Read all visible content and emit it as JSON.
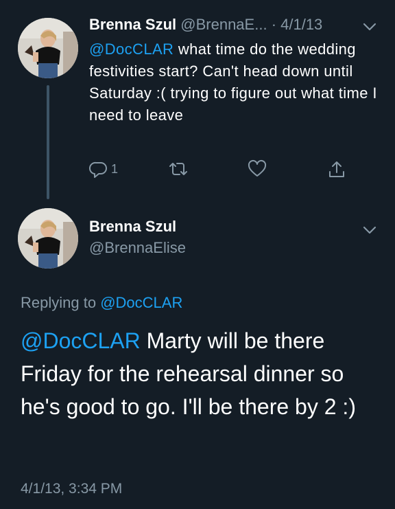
{
  "tweet1": {
    "display_name": "Brenna Szul",
    "handle": "@BrennaE...",
    "date": "· 4/1/13",
    "mention": "@DocCLAR",
    "text": " what time do the wedding festivities start? Can't head down until Saturday :( trying to figure out what time I need to leave",
    "reply_count": "1",
    "icons": [
      "reply-icon",
      "retweet-icon",
      "like-icon",
      "share-icon",
      "chevron-down-icon"
    ]
  },
  "tweet2": {
    "display_name": "Brenna Szul",
    "handle": "@BrennaElise",
    "replying_prefix": "Replying to ",
    "replying_to": "@DocCLAR",
    "mention": "@DocCLAR",
    "text": " Marty will be there Friday for the rehearsal dinner so he's good to go. I'll be there by 2 :)",
    "timestamp": "4/1/13, 3:34 PM"
  },
  "colors": {
    "background": "#141d26",
    "accent": "#1da1f2",
    "secondary_text": "#8899a6",
    "primary_text": "#ffffff",
    "thread_line": "#3d5466"
  }
}
